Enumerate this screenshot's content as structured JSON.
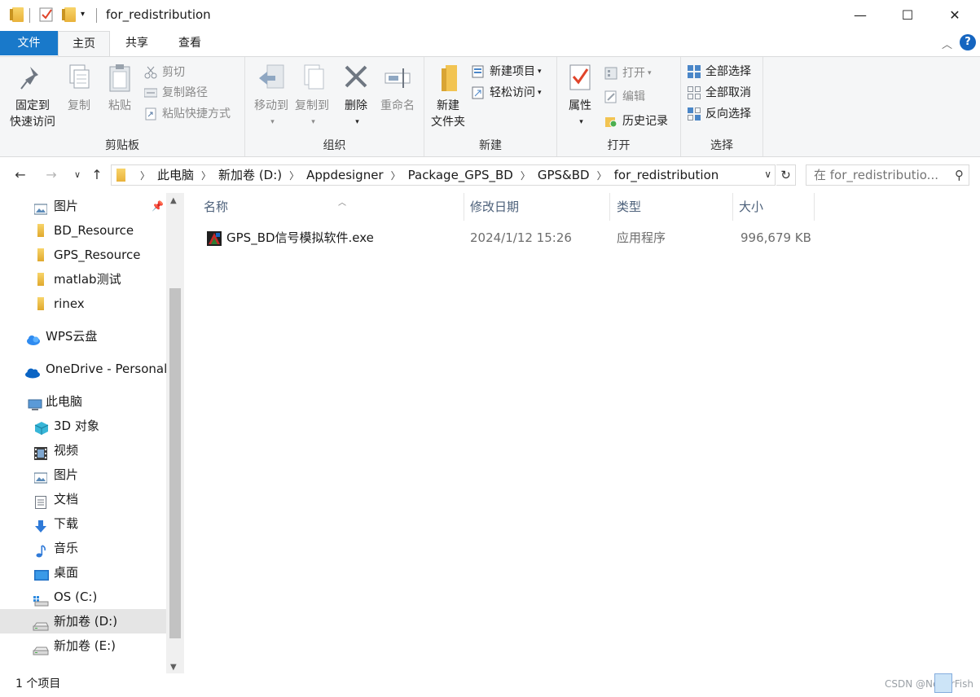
{
  "window": {
    "title": "for_redistribution",
    "minimize_glyph": "—",
    "maximize_glyph": "☐",
    "close_glyph": "✕"
  },
  "tabs": [
    "文件",
    "主页",
    "共享",
    "查看"
  ],
  "ribbon": {
    "clipboard": {
      "label": "剪贴板",
      "pin_line1": "固定到",
      "pin_line2": "快速访问",
      "copy": "复制",
      "paste": "粘贴",
      "cut": "剪切",
      "copy_path": "复制路径",
      "paste_shortcut": "粘贴快捷方式"
    },
    "organize": {
      "label": "组织",
      "move_to": "移动到",
      "copy_to": "复制到",
      "delete": "删除",
      "rename": "重命名"
    },
    "new": {
      "label": "新建",
      "new_folder_line1": "新建",
      "new_folder_line2": "文件夹",
      "new_item": "新建项目",
      "easy_access": "轻松访问"
    },
    "open": {
      "label": "打开",
      "properties": "属性",
      "open": "打开",
      "edit": "编辑",
      "history": "历史记录"
    },
    "select": {
      "label": "选择",
      "select_all": "全部选择",
      "select_none": "全部取消",
      "invert": "反向选择"
    }
  },
  "address": {
    "crumbs": [
      "此电脑",
      "新加卷 (D:)",
      "Appdesigner",
      "Package_GPS_BD",
      "GPS&BD",
      "for_redistribution"
    ]
  },
  "search": {
    "placeholder": "在 for_redistributio..."
  },
  "nav": {
    "items": [
      {
        "label": "图片",
        "icon": "pictures-icon"
      },
      {
        "label": "BD_Resource",
        "icon": "folder-icon"
      },
      {
        "label": "GPS_Resource",
        "icon": "folder-icon"
      },
      {
        "label": "matlab测试",
        "icon": "folder-icon"
      },
      {
        "label": "rinex",
        "icon": "folder-icon"
      },
      {
        "label": "WPS云盘",
        "icon": "wps-cloud-icon"
      },
      {
        "label": "OneDrive - Personal",
        "icon": "onedrive-icon"
      },
      {
        "label": "此电脑",
        "icon": "this-pc-icon"
      },
      {
        "label": "3D 对象",
        "icon": "3d-objects-icon"
      },
      {
        "label": "视频",
        "icon": "videos-icon"
      },
      {
        "label": "图片",
        "icon": "pictures-icon"
      },
      {
        "label": "文档",
        "icon": "documents-icon"
      },
      {
        "label": "下载",
        "icon": "downloads-icon"
      },
      {
        "label": "音乐",
        "icon": "music-icon"
      },
      {
        "label": "桌面",
        "icon": "desktop-icon"
      },
      {
        "label": "OS (C:)",
        "icon": "os-drive-icon"
      },
      {
        "label": "新加卷 (D:)",
        "icon": "drive-icon"
      },
      {
        "label": "新加卷 (E:)",
        "icon": "drive-icon"
      }
    ]
  },
  "columns": [
    "名称",
    "修改日期",
    "类型",
    "大小"
  ],
  "files": [
    {
      "name": "GPS_BD信号模拟软件.exe",
      "modified": "2024/1/12 15:26",
      "type": "应用程序",
      "size": "996,679 KB"
    }
  ],
  "status": {
    "count": "1 个项目",
    "watermark": "CSDN @NeverFish"
  },
  "colors": {
    "accent": "#1979ca",
    "ribbon_bg": "#f5f6f7",
    "selected_nav": "#e5e5e5",
    "header_text": "#4c607a"
  }
}
